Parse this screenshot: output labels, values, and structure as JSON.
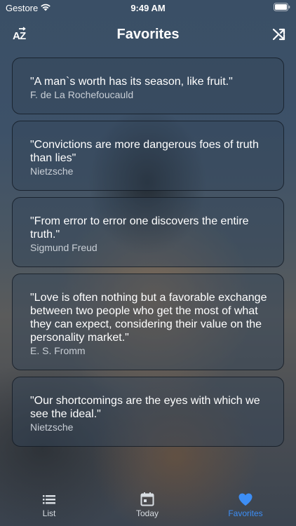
{
  "status_bar": {
    "carrier": "Gestore",
    "time": "9:49 AM"
  },
  "nav": {
    "title": "Favorites",
    "sort_icon": "sort-az-icon",
    "shuffle_icon": "shuffle-icon"
  },
  "quotes": [
    {
      "text": "\"A man`s worth has its season, like fruit.\"",
      "author": "F. de La Rochefoucauld"
    },
    {
      "text": "\"Convictions are more dangerous foes of truth than lies\"",
      "author": "Nietzsche"
    },
    {
      "text": "\"From error to error one discovers the entire truth.\"",
      "author": "Sigmund Freud"
    },
    {
      "text": "\"Love is often nothing but a favorable exchange between two people who get the most of what they can expect, considering their value on the personality market.\"",
      "author": "E. S. Fromm"
    },
    {
      "text": "\"Our shortcomings are the eyes with which we see the ideal.\"",
      "author": "Nietzsche"
    }
  ],
  "tabs": [
    {
      "label": "List",
      "icon": "list-icon"
    },
    {
      "label": "Today",
      "icon": "calendar-icon"
    },
    {
      "label": "Favorites",
      "icon": "heart-icon",
      "active": true
    }
  ],
  "colors": {
    "accent": "#3d8ef5",
    "tab_inactive": "#d8dde2",
    "author_text": "#c9cfd6"
  }
}
